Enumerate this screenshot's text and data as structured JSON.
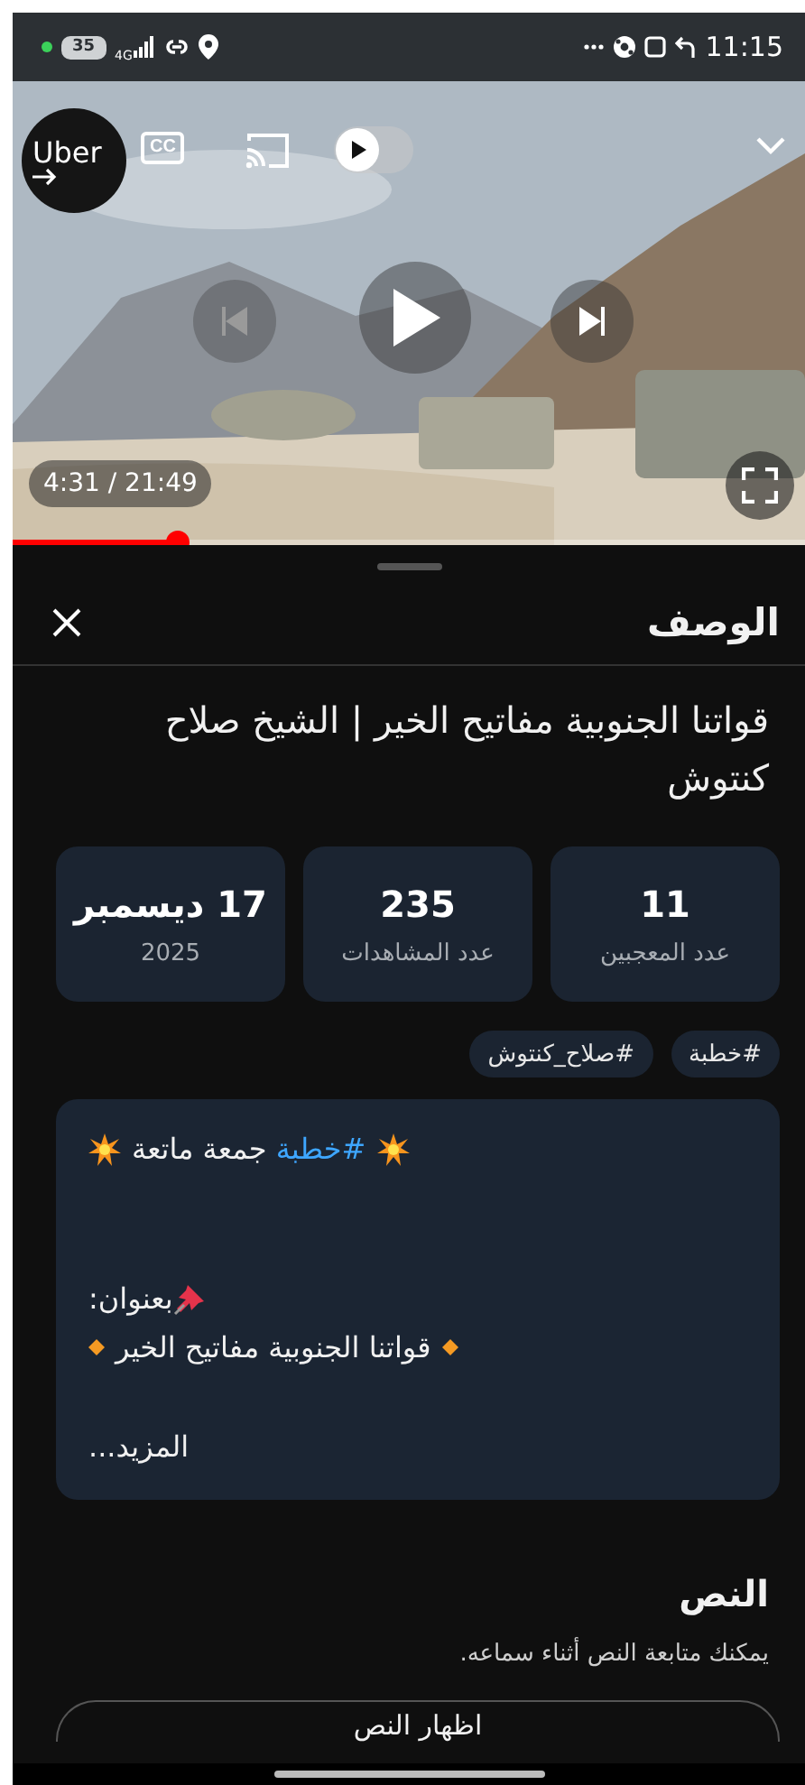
{
  "status_bar": {
    "battery": "35",
    "network": "4G",
    "time": "11:15"
  },
  "player": {
    "overlay_app": "Uber",
    "captions_label": "CC",
    "autoplay": {
      "on": false
    },
    "time": "4:31 / 21:49",
    "progress": {
      "level": 0.207
    }
  },
  "panel": {
    "title": "الوصف"
  },
  "video_title": "قواتنا الجنوبية مفاتيح الخير | الشيخ صلاح كنتوش",
  "stats": [
    {
      "value": "11",
      "label": "عدد المعجبين"
    },
    {
      "value": "235",
      "label": "عدد المشاهدات"
    },
    {
      "value": "17 ديسمبر",
      "label": "2025"
    }
  ],
  "tags": [
    "#خطبة",
    "#صلاح_كنتوش"
  ],
  "description": {
    "lines": [
      {
        "kind": "headline",
        "parts": [
          {
            "kind": "hashtag",
            "text": "#خطبة"
          },
          {
            "kind": "plain",
            "text": " جمعة ماتعة"
          }
        ]
      },
      {
        "kind": "pinned",
        "text": "بعنوان:"
      },
      {
        "kind": "bullet",
        "text": "قواتنا الجنوبية مفاتيح الخير"
      }
    ],
    "more": "المزيد..."
  },
  "transcript": {
    "title": "النص",
    "subtitle": "يمكنك متابعة النص أثناء سماعه.",
    "button": "اظهار النص"
  }
}
